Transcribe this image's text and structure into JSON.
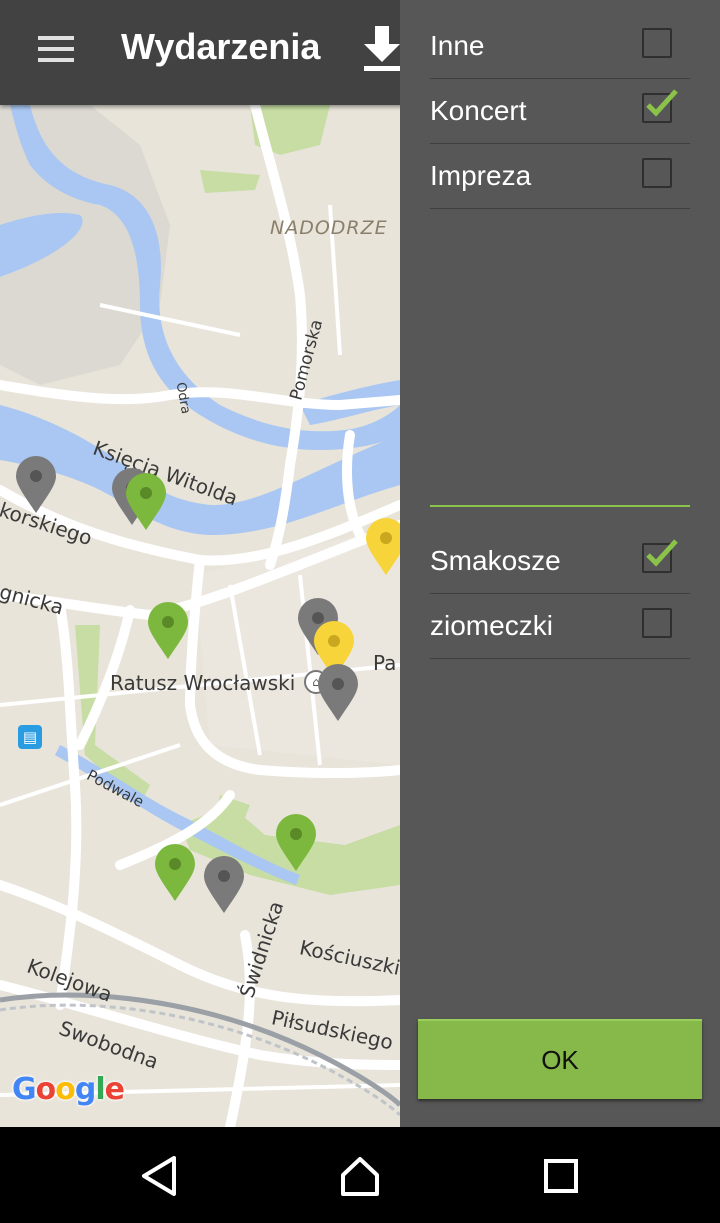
{
  "toolbar": {
    "title": "Wydarzenia",
    "menu_icon": "hamburger-menu-icon",
    "download_icon": "download-icon",
    "background": "#424242"
  },
  "map": {
    "labels": {
      "nadodrze": "NADODRZE",
      "pomorska": "Pomorska",
      "odra": "Odra",
      "ksiecia_witolda": "Księcia Witolda",
      "korskiego": "korskiego",
      "legnicka": "gnicka",
      "ratusz": "Ratusz Wrocławski",
      "pa": "Pa",
      "podwale": "Podwale",
      "swidnicka": "Świdnicka",
      "kosciuszki": "Kościuszki",
      "kolejowa": "Kolejowa",
      "pilsudskiego": "Piłsudskiego",
      "swobodna": "Swobodna"
    },
    "google_logo": {
      "G": "G",
      "o1": "o",
      "o2": "o",
      "g": "g",
      "l": "l",
      "e": "e"
    },
    "pin_colors": {
      "gray": "#7a7a7a",
      "green": "#7cb83e",
      "yellow": "#f7d43a"
    }
  },
  "drawer": {
    "group1": [
      {
        "label": "Inne",
        "checked": false
      },
      {
        "label": "Koncert",
        "checked": true
      },
      {
        "label": "Impreza",
        "checked": false
      }
    ],
    "group2": [
      {
        "label": "Smakosze",
        "checked": true
      },
      {
        "label": "ziomeczki",
        "checked": false
      }
    ],
    "ok_label": "OK",
    "accent": "#8bc34a"
  },
  "navbar": {
    "back_icon": "back-triangle-icon",
    "home_icon": "home-icon",
    "recents_icon": "recents-square-icon"
  }
}
